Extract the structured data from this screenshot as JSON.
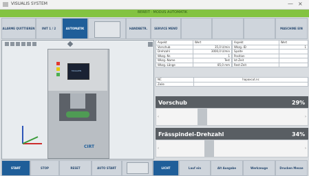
{
  "window": {
    "title": "VISUALIS SYSTEM",
    "controls": [
      "—",
      "×"
    ]
  },
  "status_bar": {
    "text": "BEREIT · MODUS AUTOMATIK"
  },
  "top_buttons": [
    {
      "label": "ALARME QUITTIEREN",
      "active": false
    },
    {
      "label": "INIT 1 / 2",
      "active": false
    },
    {
      "label": "AUTOMATIK",
      "active": true
    },
    {
      "label": "",
      "active": false
    },
    {
      "label": "HANDBETR.",
      "active": false
    },
    {
      "label": "SERVICE MENÜ",
      "active": false
    },
    {
      "label": "",
      "active": false
    },
    {
      "label": "",
      "active": false
    },
    {
      "label": "MASCHINE EIN",
      "active": false
    }
  ],
  "bottom_buttons": [
    {
      "label": "START",
      "active": true
    },
    {
      "label": "STOP",
      "active": false
    },
    {
      "label": "RESET",
      "active": false
    },
    {
      "label": "AUTO START",
      "active": false
    },
    {
      "label": "",
      "active": false
    },
    {
      "label": "LICHT",
      "active": true
    },
    {
      "label": "Lauf ein",
      "active": false
    },
    {
      "label": "Alt Ausgabe",
      "active": false
    },
    {
      "label": "Werkzeuge",
      "active": false
    },
    {
      "label": "Drucken Messe",
      "active": false
    }
  ],
  "viewer": {
    "machine_brand": "CIRT",
    "monitor_label": "MAGAZIN"
  },
  "info_left": {
    "headers": [
      "Aspekt",
      "Wert"
    ],
    "rows": [
      [
        "Vorschub",
        "35,0 U/min"
      ],
      [
        "Drehzahl",
        "3000,0 U/min"
      ],
      [
        "Wkzg.-Nr.",
        "1"
      ],
      [
        "Wkzg.-Name",
        "Test"
      ],
      [
        "Wkzg.-Länge",
        "85,0 mm"
      ]
    ]
  },
  "info_right": {
    "headers": [
      "Aspekt",
      "Wert"
    ],
    "rows": [
      [
        "Wkzg.-ID",
        "1"
      ],
      [
        "Spalte",
        ""
      ],
      [
        "Position",
        ""
      ],
      [
        "Ist-Zeit",
        ""
      ],
      [
        "Rest-Zeit",
        ""
      ]
    ]
  },
  "program": {
    "label": "NC",
    "value": "hapaxcut.nc",
    "status_label": "Zeile",
    "status_value": ""
  },
  "sliders": [
    {
      "title": "Vorschub",
      "percent_text": "29%",
      "level": 0.29
    },
    {
      "title": "Frässpindel-Drehzahl",
      "percent_text": "34%",
      "level": 0.34
    }
  ]
}
